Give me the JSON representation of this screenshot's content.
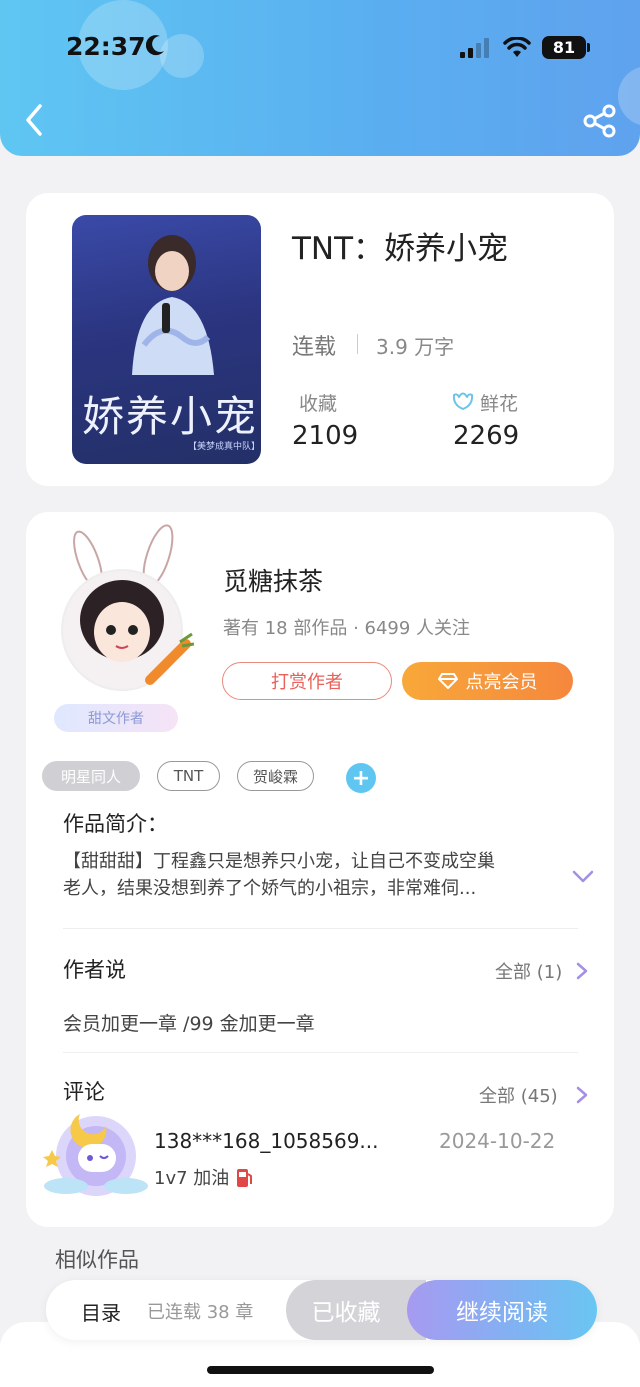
{
  "status_bar": {
    "time": "22:37",
    "battery": "81"
  },
  "colors": {
    "header_start": "#5fc6f2",
    "header_end": "#5fa2ee",
    "accent_orange": "#f5873d",
    "accent_red": "#e8615a",
    "link_blue": "#5fc6f2"
  },
  "book": {
    "title": "TNT：娇养小宠",
    "status": "连载",
    "word_count": "3.9 万字",
    "favorites_label": "收藏",
    "favorites_value": "2109",
    "flowers_label": "鲜花",
    "flowers_value": "2269",
    "cover": {
      "title_art": "娇养小宠",
      "subtitle": "【美梦成真中队】"
    }
  },
  "author": {
    "name": "觅糖抹茶",
    "stats": "著有 18 部作品 · 6499 人关注",
    "badge": "甜文作者",
    "reward_button": "打赏作者",
    "vip_button": "点亮会员"
  },
  "tags": [
    "明星同人",
    "TNT",
    "贺峻霖"
  ],
  "tag_add": "+",
  "synopsis": {
    "label": "作品简介：",
    "line1": "【甜甜甜】丁程鑫只是想养只小宠，让自己不变成空巢",
    "line2": "老人，结果没想到养了个娇气的小祖宗，非常难伺..."
  },
  "author_says": {
    "label": "作者说",
    "see_all": "全部 (1)",
    "note": "会员加更一章 /99 金加更一章"
  },
  "comments": {
    "label": "评论",
    "see_all": "全部 (45)",
    "items": [
      {
        "user": "138***168_1058569...",
        "date": "2024-10-22",
        "text": "1v7 加油"
      }
    ]
  },
  "similar_label": "相似作品",
  "bottom_bar": {
    "toc": "目录",
    "chapters": "已连载 38 章",
    "saved_button": "已收藏",
    "read_button": "继续阅读"
  },
  "icons": [
    "moon-icon",
    "signal-icon",
    "wifi-icon",
    "back-icon",
    "share-icon",
    "flower-icon",
    "gem-icon",
    "chevron-down-icon",
    "chevron-right-icon",
    "fuel-icon"
  ]
}
